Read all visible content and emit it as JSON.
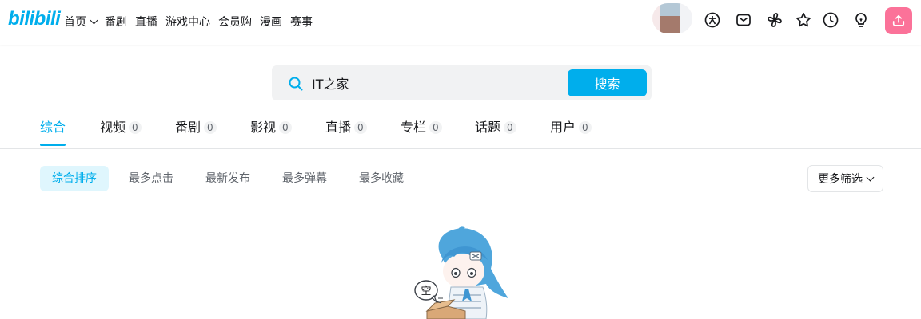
{
  "header": {
    "logo": "bilibili",
    "nav": [
      {
        "label": "首页",
        "icon": "chevron-down-icon"
      },
      {
        "label": "番剧"
      },
      {
        "label": "直播"
      },
      {
        "label": "游戏中心"
      },
      {
        "label": "会员购"
      },
      {
        "label": "漫画"
      },
      {
        "label": "赛事"
      }
    ],
    "right_icons": [
      "vip-icon",
      "message-icon",
      "dynamic-icon",
      "favorite-icon",
      "history-icon",
      "creation-icon",
      "upload-icon"
    ]
  },
  "search": {
    "value": "IT之家",
    "button": "搜索"
  },
  "tabs": [
    {
      "label": "综合",
      "count": null,
      "active": true
    },
    {
      "label": "视频",
      "count": "0"
    },
    {
      "label": "番剧",
      "count": "0"
    },
    {
      "label": "影视",
      "count": "0"
    },
    {
      "label": "直播",
      "count": "0"
    },
    {
      "label": "专栏",
      "count": "0"
    },
    {
      "label": "话题",
      "count": "0"
    },
    {
      "label": "用户",
      "count": "0"
    }
  ],
  "sorts": [
    {
      "label": "综合排序",
      "active": true
    },
    {
      "label": "最多点击"
    },
    {
      "label": "最新发布"
    },
    {
      "label": "最多弹幕"
    },
    {
      "label": "最多收藏"
    }
  ],
  "more_filter": "更多筛选",
  "empty": {
    "bubble": "空"
  },
  "colors": {
    "accent": "#00aeec",
    "upload": "#fb7299",
    "active_bg": "#dff6fd"
  }
}
